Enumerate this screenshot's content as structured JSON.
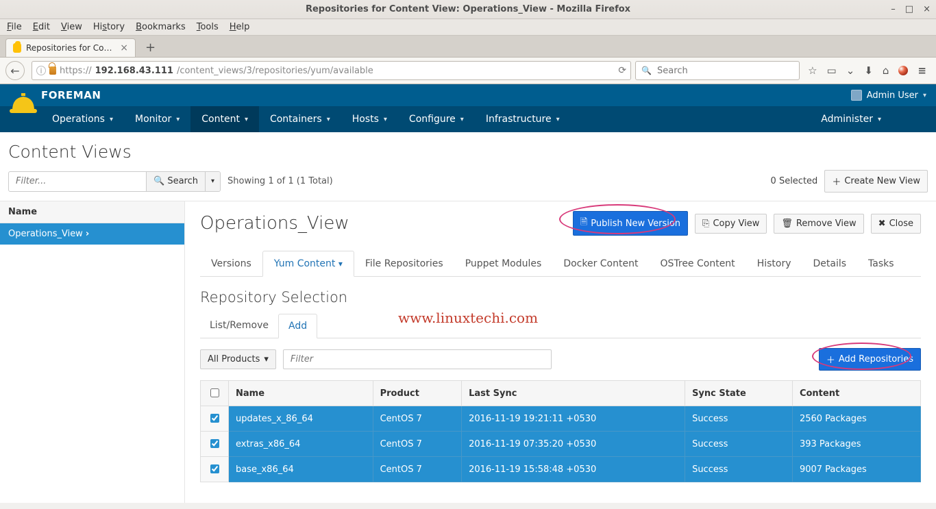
{
  "window": {
    "title": "Repositories for Content View: Operations_View - Mozilla Firefox",
    "controls": {
      "min": "–",
      "max": "□",
      "close": "×"
    }
  },
  "menubar": [
    "File",
    "Edit",
    "View",
    "History",
    "Bookmarks",
    "Tools",
    "Help"
  ],
  "browser_tab": {
    "label": "Repositories for Conten...",
    "close": "×",
    "new": "+"
  },
  "urlbar": {
    "bold": "192.168.43.111",
    "rest": "/content_views/3/repositories/yum/available",
    "scheme": "https://"
  },
  "searchbar": {
    "placeholder": "Search",
    "icon": "🔍"
  },
  "tb_icons": {
    "star": "☆",
    "panel": "▭",
    "pocket": "⌄",
    "down": "⬇",
    "home": "⌂",
    "menu": "≡"
  },
  "foreman": {
    "brand": "FOREMAN",
    "admin_user": "Admin User",
    "nav": [
      "Operations",
      "Monitor",
      "Content",
      "Containers",
      "Hosts",
      "Configure",
      "Infrastructure"
    ],
    "nav_admin": "Administer"
  },
  "page": {
    "title": "Content Views",
    "filter_placeholder": "Filter...",
    "search_btn": "Search",
    "showing": "Showing 1 of 1 (1 Total)",
    "selected": "0 Selected",
    "create_btn": "Create New View",
    "side_head": "Name",
    "side_item": "Operations_View"
  },
  "view": {
    "title": "Operations_View",
    "buttons": {
      "publish": "Publish New Version",
      "copy": "Copy View",
      "remove": "Remove View",
      "close": "Close"
    },
    "tabs": [
      "Versions",
      "Yum Content",
      "File Repositories",
      "Puppet Modules",
      "Docker Content",
      "OSTree Content",
      "History",
      "Details",
      "Tasks"
    ],
    "section": "Repository Selection",
    "subtabs": [
      "List/Remove",
      "Add"
    ],
    "allprod": "All Products",
    "repofilter_placeholder": "Filter",
    "addrepo_btn": "Add Repositories",
    "cols": [
      "Name",
      "Product",
      "Last Sync",
      "Sync State",
      "Content"
    ],
    "rows": [
      {
        "name": "updates_x_86_64",
        "product": "CentOS 7",
        "sync": "2016-11-19 19:21:11 +0530",
        "state": "Success",
        "content": "2560 Packages",
        "checked": true
      },
      {
        "name": "extras_x86_64",
        "product": "CentOS 7",
        "sync": "2016-11-19 07:35:20 +0530",
        "state": "Success",
        "content": "393 Packages",
        "checked": true
      },
      {
        "name": "base_x86_64",
        "product": "CentOS 7",
        "sync": "2016-11-19 15:58:48 +0530",
        "state": "Success",
        "content": "9007 Packages",
        "checked": true
      }
    ]
  },
  "watermark": "www.linuxtechi.com"
}
